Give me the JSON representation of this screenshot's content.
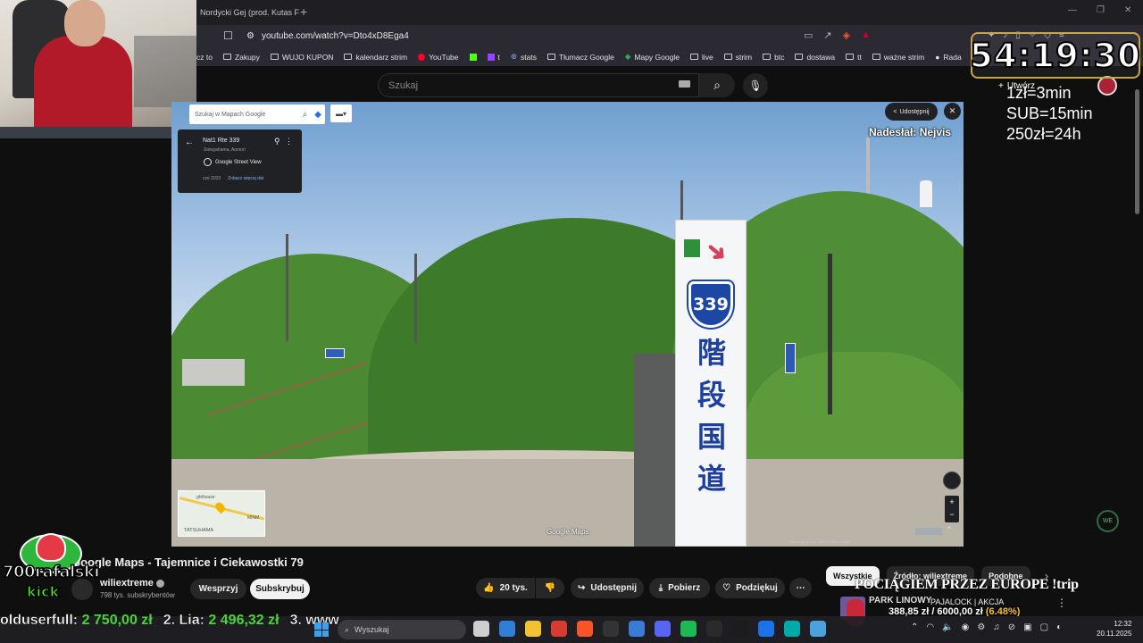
{
  "browser": {
    "tab_title": "Nordycki Gej (prod. Kutas F",
    "new_tab": "+",
    "window_controls": [
      "—",
      "❐",
      "✕"
    ],
    "url": "youtube.com/watch?v=Dto4xD8Ega4",
    "bookmarks": [
      {
        "label": "cz to",
        "icon": "none"
      },
      {
        "label": "Zakupy",
        "icon": "folder-icon"
      },
      {
        "label": "WUJO KUPON",
        "icon": "folder-icon"
      },
      {
        "label": "kalendarz strim",
        "icon": "folder-icon"
      },
      {
        "label": "YouTube",
        "icon": "youtube-icon"
      },
      {
        "label": "",
        "icon": "kick-icon"
      },
      {
        "label": "t",
        "icon": "twitch-icon"
      },
      {
        "label": "stats",
        "icon": "link-icon"
      },
      {
        "label": "Tłumacz Google",
        "icon": "folder-icon"
      },
      {
        "label": "Mapy Google",
        "icon": "maps-icon"
      },
      {
        "label": "live",
        "icon": "folder-icon"
      },
      {
        "label": "strim",
        "icon": "folder-icon"
      },
      {
        "label": "btc",
        "icon": "folder-icon"
      },
      {
        "label": "dostawa",
        "icon": "folder-icon"
      },
      {
        "label": "tt",
        "icon": "folder-icon"
      },
      {
        "label": "ważne strim",
        "icon": "folder-icon"
      },
      {
        "label": "Rada",
        "icon": "link-icon"
      }
    ],
    "overflow_icon": "»"
  },
  "youtube": {
    "search_placeholder": "Szukaj",
    "create_label": "Utwórz",
    "video_title": "Google Maps - Tajemnice i Ciekawostki 79",
    "channel_name": "wiliextreme",
    "channel_subs": "798 tys. subskrybentów",
    "support_label": "Wesprzyj",
    "subscribe_label": "Subskrybuj",
    "likes": "20 tys.",
    "share_label": "Udostępnij",
    "download_label": "Pobierz",
    "thanks_label": "Podziękuj",
    "more_label": "⋯",
    "chips": [
      "Wszystkie",
      "Źródło: wiliextreme",
      "Podobne"
    ],
    "chip_next": "›"
  },
  "stream_overlay": {
    "timer": "54:19:30",
    "rates": [
      "1zł=3min",
      "SUB=15min",
      "250zł=24h"
    ],
    "kick_name": "700rafalski",
    "kick_word": "kick",
    "trip_banner": "POCIĄGIEM PRZEZ EUROPE !trip",
    "sponsor_title": "PARK LINOWY",
    "sponsor_sub": "PAJALOCK | AKCJA",
    "goal_amount": "388,85 zł / 6000,00 zł",
    "goal_pct": "(6.48%)",
    "ticker": [
      {
        "name": "olduserfull:",
        "amount": "2 750,00 zł"
      },
      {
        "name": "2. Lia:",
        "amount": "2 496,32 zł"
      },
      {
        "name": "3. www",
        "amount": ""
      }
    ]
  },
  "maps": {
    "search_placeholder": "Szukaj w Mapach Google",
    "place_title": "Nat1 Rte 339",
    "place_sub": "Sotogahama, Aomori",
    "street_view_label": "Google Street View",
    "capture_date": "cze 2023",
    "more_dates": "Zobacz więcej dat",
    "share_label": "Udostępnij",
    "nadeslal": "Nadesłał: Nejvis",
    "minimap_label": "TATSUHAMA",
    "minimap_label2": "MINM",
    "minimap_label3": "ghthouse",
    "google_maps_logo": "Google Maps",
    "footer": "Data zdjęcia: cze 2023   © 2025 Google",
    "sign_route": "339",
    "sign_text": [
      "階",
      "段",
      "国",
      "道"
    ]
  },
  "taskbar": {
    "search_placeholder": "Wyszukaj",
    "time": "12:32",
    "date": "20.11.2025",
    "app_colors": [
      "#cfcfcf",
      "#2f7fd8",
      "#f2c230",
      "#d83b2f",
      "#fb542b",
      "#333333",
      "#3a7bd5",
      "#5865f2",
      "#1db954",
      "#2a2a2a",
      "#1c1c1c",
      "#1a73e8",
      "#0aa",
      "#4aa3df"
    ]
  },
  "colors": {
    "accent_green": "#53fc18",
    "timer_border": "#c7a54a",
    "sign_blue": "#1d47a5"
  }
}
